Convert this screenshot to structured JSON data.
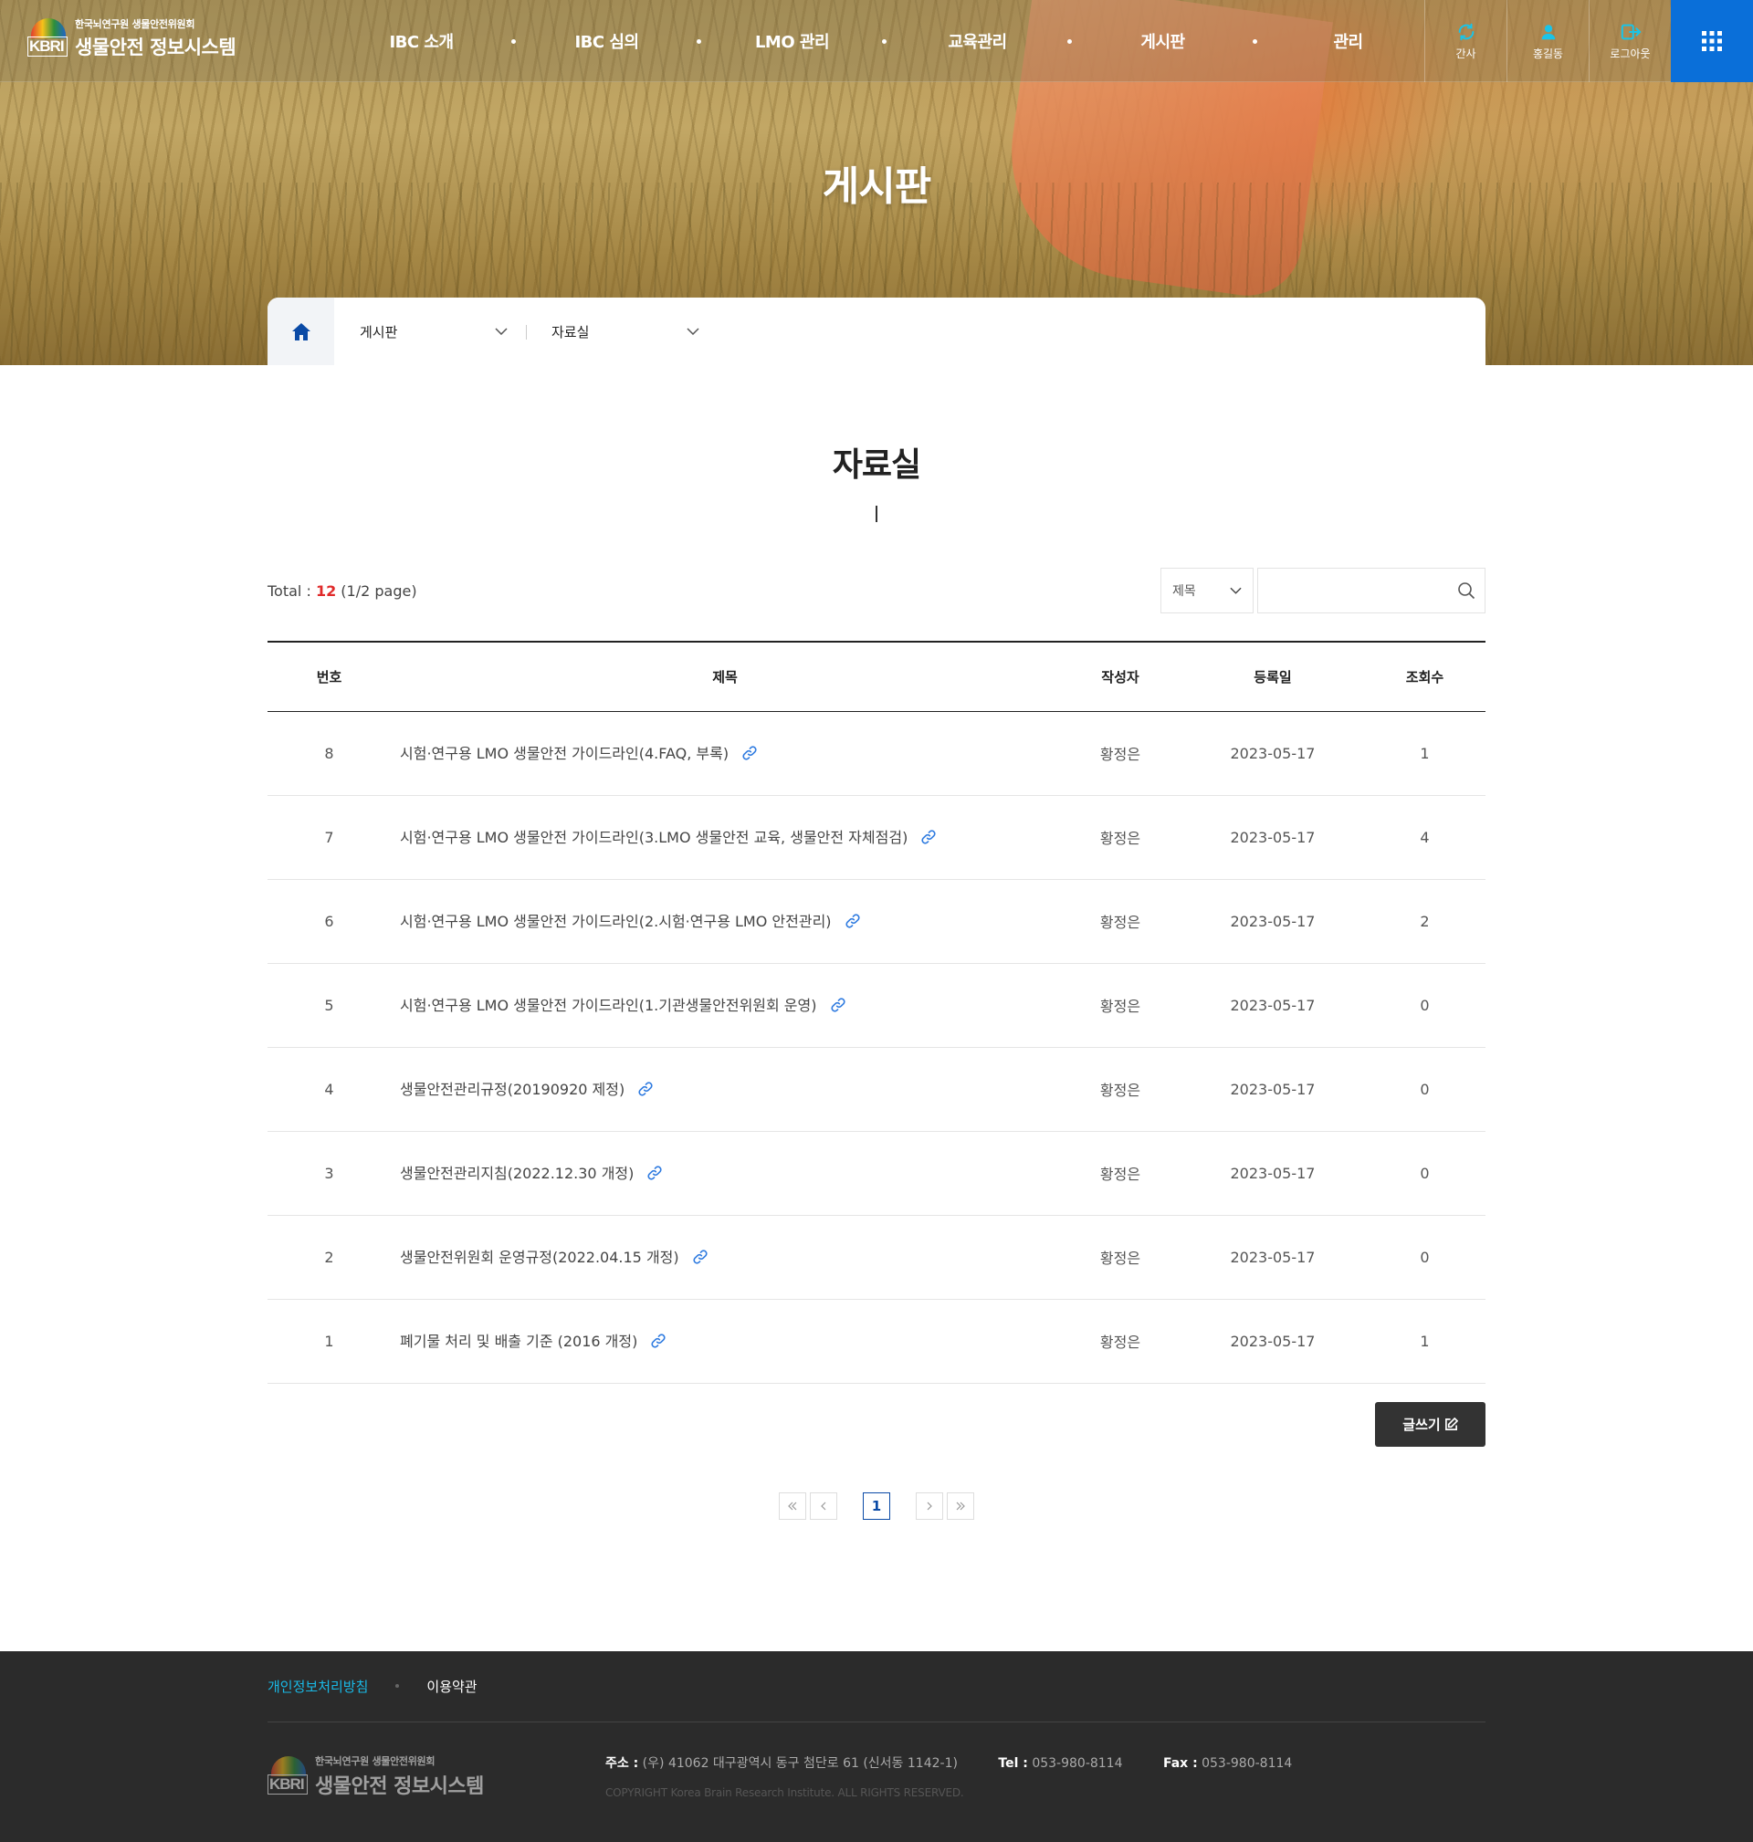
{
  "header": {
    "logo_sub": "한국뇌연구원 생물안전위원회",
    "logo_main": "생물안전 정보시스템",
    "logo_mark": "KBRI",
    "nav": [
      "IBC 소개",
      "IBC 심의",
      "LMO 관리",
      "교육관리",
      "게시판",
      "관리"
    ],
    "util": [
      {
        "label": "간사",
        "icon": "refresh-icon"
      },
      {
        "label": "홍길동",
        "icon": "user-icon"
      },
      {
        "label": "로그아웃",
        "icon": "logout-icon"
      }
    ],
    "colors": {
      "accent": "#0a6fd9",
      "util_icon": "#19c4e8"
    }
  },
  "hero": {
    "title": "게시판"
  },
  "location": {
    "level1": "게시판",
    "level2": "자료실"
  },
  "board": {
    "title": "자료실",
    "total_label": "Total : ",
    "total_count": "12",
    "total_page": " (1/2 page)",
    "search_select": "제목",
    "search_value": "",
    "search_placeholder": "",
    "columns": [
      "번호",
      "제목",
      "작성자",
      "등록일",
      "조회수"
    ],
    "rows": [
      {
        "no": "8",
        "title": "시험·연구용 LMO 생물안전 가이드라인(4.FAQ, 부록)",
        "author": "황정은",
        "date": "2023-05-17",
        "views": "1"
      },
      {
        "no": "7",
        "title": "시험·연구용 LMO 생물안전 가이드라인(3.LMO 생물안전 교육, 생물안전 자체점검)",
        "author": "황정은",
        "date": "2023-05-17",
        "views": "4"
      },
      {
        "no": "6",
        "title": "시험·연구용 LMO 생물안전 가이드라인(2.시험·연구용 LMO 안전관리)",
        "author": "황정은",
        "date": "2023-05-17",
        "views": "2"
      },
      {
        "no": "5",
        "title": "시험·연구용 LMO 생물안전 가이드라인(1.기관생물안전위원회 운영)",
        "author": "황정은",
        "date": "2023-05-17",
        "views": "0"
      },
      {
        "no": "4",
        "title": "생물안전관리규정(20190920 제정)",
        "author": "황정은",
        "date": "2023-05-17",
        "views": "0"
      },
      {
        "no": "3",
        "title": "생물안전관리지침(2022.12.30 개정)",
        "author": "황정은",
        "date": "2023-05-17",
        "views": "0"
      },
      {
        "no": "2",
        "title": "생물안전위원회 운영규정(2022.04.15 개정)",
        "author": "황정은",
        "date": "2023-05-17",
        "views": "0"
      },
      {
        "no": "1",
        "title": "폐기물 처리 및 배출 기준 (2016 개정)",
        "author": "황정은",
        "date": "2023-05-17",
        "views": "1"
      }
    ],
    "write_label": "글쓰기",
    "current_page": "1"
  },
  "footer": {
    "privacy": "개인정보처리방침",
    "terms": "이용약관",
    "logo_sub": "한국뇌연구원 생물안전위원회",
    "logo_main": "생물안전 정보시스템",
    "logo_mark": "KBRI",
    "addr_label": "주소 :",
    "addr": " (우) 41062 대구광역시 동구 첨단로 61 (신서동 1142-1)",
    "tel_label": "Tel :",
    "tel": " 053-980-8114",
    "fax_label": "Fax :",
    "fax": " 053-980-8114",
    "copyright": "COPYRIGHT Korea Brain Research Institute. ALL RIGHTS RESERVED."
  }
}
